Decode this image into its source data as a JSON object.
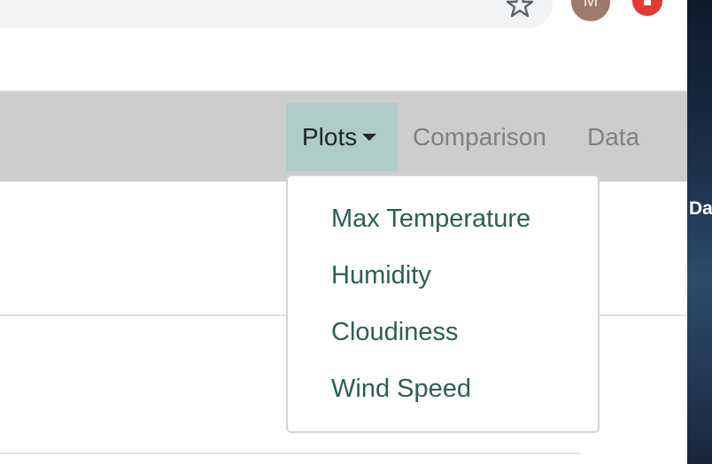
{
  "browser": {
    "avatar_initial": "M",
    "icons": [
      "star-icon",
      "update-arrow-icon"
    ],
    "accent_colors": {
      "avatar": "#9b7b6c",
      "update_badge": "#e53935"
    }
  },
  "navbar": {
    "items": [
      {
        "label": "Plots",
        "active": true,
        "has_dropdown": true
      },
      {
        "label": "Comparison"
      },
      {
        "label": "Data"
      }
    ],
    "colors": {
      "background": "#cdcdcd",
      "active_background": "#aecdc8",
      "link": "#808080"
    }
  },
  "dropdown": {
    "items": [
      {
        "label": "Max Temperature"
      },
      {
        "label": "Humidity"
      },
      {
        "label": "Cloudiness"
      },
      {
        "label": "Wind Speed"
      }
    ],
    "item_color": "#2e5e55"
  },
  "desktop": {
    "label": "Da"
  }
}
